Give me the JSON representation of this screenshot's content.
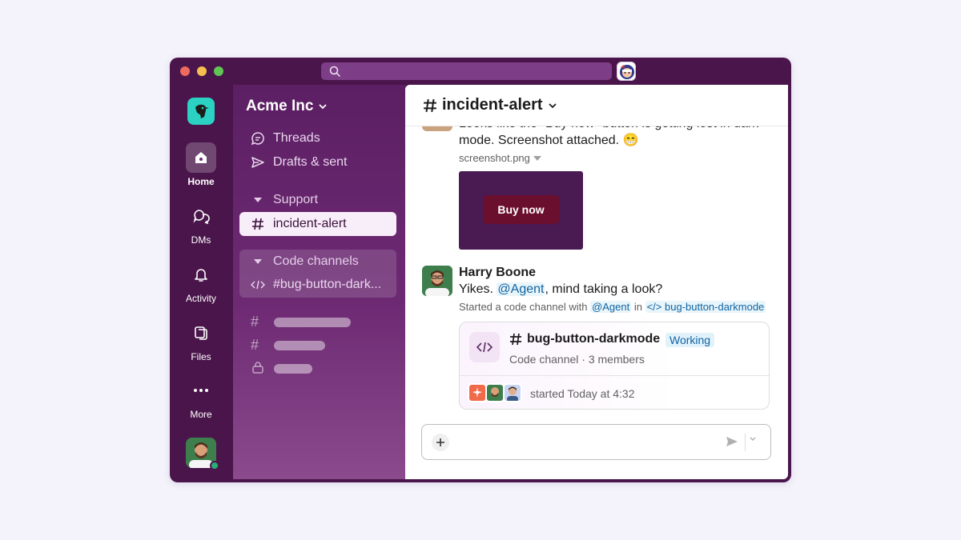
{
  "workspace": {
    "name": "Acme Inc"
  },
  "rail": {
    "items": [
      {
        "label": "Home",
        "icon": "home-icon"
      },
      {
        "label": "DMs",
        "icon": "dms-icon"
      },
      {
        "label": "Activity",
        "icon": "bell-icon"
      },
      {
        "label": "Files",
        "icon": "files-icon"
      },
      {
        "label": "More",
        "icon": "more-icon"
      }
    ]
  },
  "sidebar": {
    "threads": "Threads",
    "drafts": "Drafts & sent",
    "support_section": "Support",
    "active_channel": "incident-alert",
    "code_section": "Code channels",
    "code_channel": "#bug-button-dark..."
  },
  "channel": {
    "name": "incident-alert"
  },
  "messages": {
    "cut_line": "Looks like the \"Buy now\" button is getting lost in dark",
    "line2": "mode. Screenshot attached. 😁",
    "file_name": "screenshot.png",
    "screenshot_button": "Buy now",
    "author": "Harry Boone",
    "text_pre": "Yikes. ",
    "mention": "@Agent",
    "text_post": ", mind taking a look?",
    "sub_pre": "Started a code channel with ",
    "sub_mention": "@Agent",
    "sub_mid": " in ",
    "sub_channel": "</> bug-button-darkmode"
  },
  "card": {
    "title": "bug-button-darkmode",
    "status": "Working",
    "subtitle": "Code channel · 3 members",
    "footer": "started Today at 4:32"
  },
  "colors": {
    "window": "#4a154b",
    "accent": "#1264a3",
    "brand_logo": "#2bd1c2",
    "buy_button": "#6b0f2e"
  }
}
